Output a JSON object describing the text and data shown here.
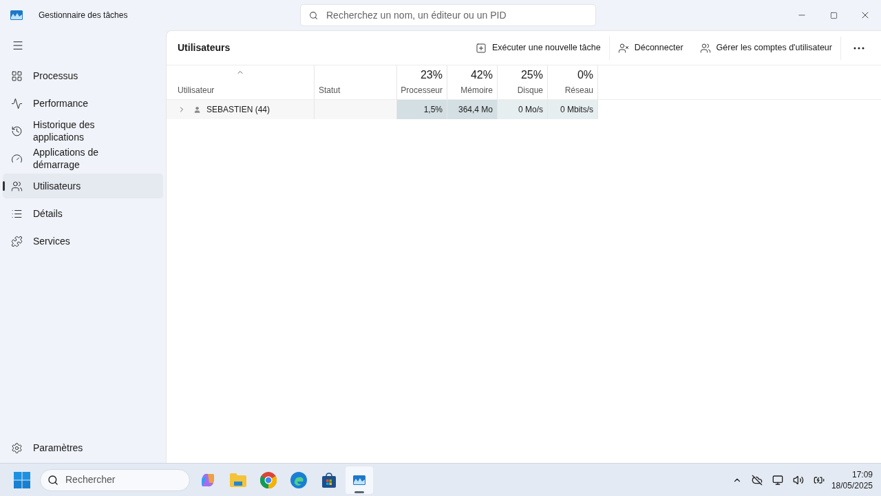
{
  "window": {
    "title": "Gestionnaire des tâches"
  },
  "search": {
    "placeholder": "Recherchez un nom, un éditeur ou un PID"
  },
  "sidebar": {
    "items": [
      {
        "label": "Processus",
        "selected": false
      },
      {
        "label": "Performance",
        "selected": false
      },
      {
        "label": "Historique des applications",
        "selected": false
      },
      {
        "label": "Applications de démarrage",
        "selected": false
      },
      {
        "label": "Utilisateurs",
        "selected": true
      },
      {
        "label": "Détails",
        "selected": false
      },
      {
        "label": "Services",
        "selected": false
      }
    ],
    "footer": {
      "label": "Paramètres"
    }
  },
  "page": {
    "title": "Utilisateurs",
    "actions": [
      "Exécuter une nouvelle tâche",
      "Déconnecter",
      "Gérer les comptes d'utilisateur"
    ]
  },
  "table": {
    "columns": [
      {
        "label": "Utilisateur",
        "sorted": true
      },
      {
        "label": "Statut",
        "sorted": false
      },
      {
        "label": "Processeur",
        "total": "23%",
        "sorted": false
      },
      {
        "label": "Mémoire",
        "total": "42%",
        "sorted": false
      },
      {
        "label": "Disque",
        "total": "25%",
        "sorted": false
      },
      {
        "label": "Réseau",
        "total": "0%",
        "sorted": false
      }
    ],
    "rows": [
      {
        "expanded": false,
        "cells": [
          {
            "text": "SEBASTIEN (44)"
          },
          {
            "text": ""
          },
          {
            "text": "1,5%",
            "color": "#d3dfe3"
          },
          {
            "text": "364,4 Mo",
            "color": "#d3dfe3"
          },
          {
            "text": "0 Mo/s",
            "color": "#e6eef0"
          },
          {
            "text": "0 Mbits/s",
            "color": "#e6eef0"
          }
        ]
      }
    ]
  },
  "taskbar": {
    "search_placeholder": "Rechercher",
    "time": "17:09",
    "date": "18/05/2025"
  }
}
